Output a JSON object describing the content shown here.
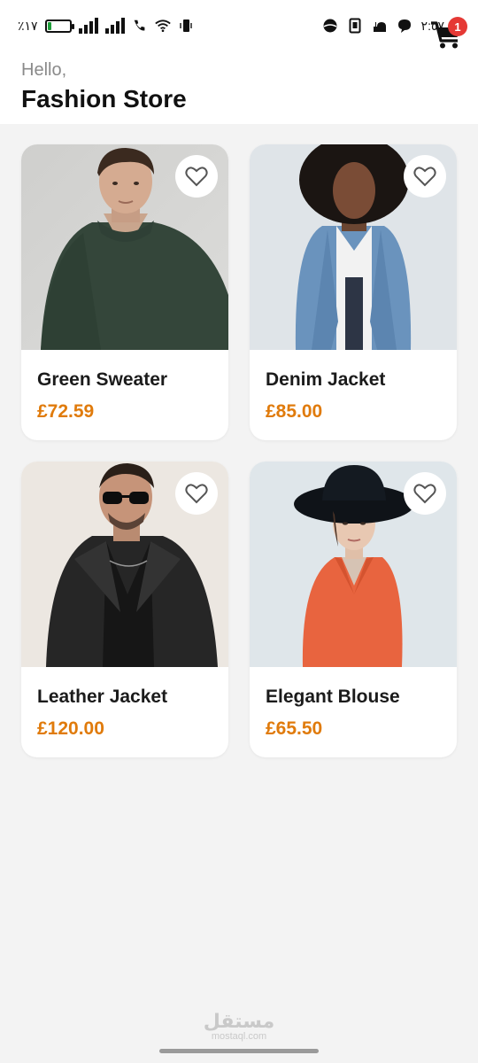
{
  "status_bar": {
    "battery_text": "٪١٧",
    "battery_level": 0.17,
    "time": "٢:٥٧"
  },
  "header": {
    "greeting": "Hello,",
    "title": "Fashion Store",
    "cart_count": "1"
  },
  "products": [
    {
      "name": "Green Sweater",
      "price": "£72.59",
      "image": "man-green-sweater"
    },
    {
      "name": "Denim Jacket",
      "price": "£85.00",
      "image": "woman-denim-jacket"
    },
    {
      "name": "Leather Jacket",
      "price": "£120.00",
      "image": "man-leather-jacket-sunglasses"
    },
    {
      "name": "Elegant Blouse",
      "price": "£65.50",
      "image": "woman-black-hat-orange-blouse"
    }
  ],
  "watermark": {
    "arabic": "مستقل",
    "latin": "mostaql.com"
  },
  "colors": {
    "price": "#e07b0c",
    "badge": "#e53935",
    "background": "#f3f3f3"
  }
}
